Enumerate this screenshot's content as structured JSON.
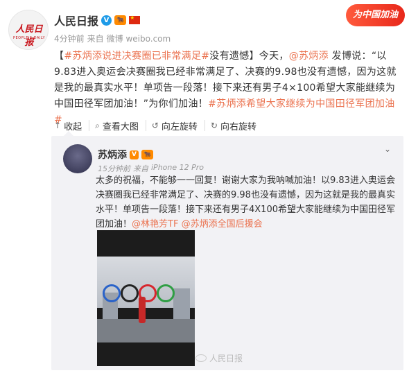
{
  "header": {
    "logo_text": "人民日报",
    "logo_subtext": "PEOPLE'S DAILY",
    "name": "人民日报",
    "verified_icon": "verified-blue-badge",
    "time": "4分钟前",
    "source_prefix": "来自",
    "source_name": "微博 weibo.com",
    "promo_label": "为中国加油"
  },
  "post": {
    "segments": [
      {
        "text": "【",
        "type": "plain"
      },
      {
        "text": "#苏炳添说进决赛圈已非常满足#",
        "type": "hash"
      },
      {
        "text": "没有遗憾】今天，",
        "type": "plain"
      },
      {
        "text": "@苏炳添",
        "type": "at"
      },
      {
        "text": " 发博说：“以9.83进入奥运会决赛圈我已经非常满足了、决赛的9.98也没有遗憾，因为这就是我的最真实水平！单项告一段落！接下来还有男子4×100希望大家能继续为中国田径军团加油！”为你们加油！",
        "type": "plain"
      },
      {
        "text": "#苏炳添希望大家继续为中国田径军团加油#",
        "type": "hash"
      }
    ]
  },
  "toolbar": {
    "collect": "收起",
    "view_large": "查看大图",
    "rotate_left": "向左旋转",
    "rotate_right": "向右旋转"
  },
  "retweet": {
    "name": "苏炳添",
    "time": "15分钟前",
    "source_prefix": "来自",
    "device": "iPhone 12 Pro",
    "text_plain": "太多的祝福，不能够一一回复！谢谢大家为我呐喊加油！以9.83进入奥运会决赛圈我已经非常满足了、决赛的9.98也没有遗憾，因为这就是我的最真实水平！单项告一段落！接下来还有男子4X100希望大家能继续为中国田径军团加油！",
    "mention1": "@林艳芳TF",
    "mention2": "@苏炳添全国后援会"
  },
  "watermark": "人民日报",
  "colors": {
    "link": "#eb7350",
    "verified": "#1e9be8",
    "retweet_bg": "#f2f2f5"
  }
}
